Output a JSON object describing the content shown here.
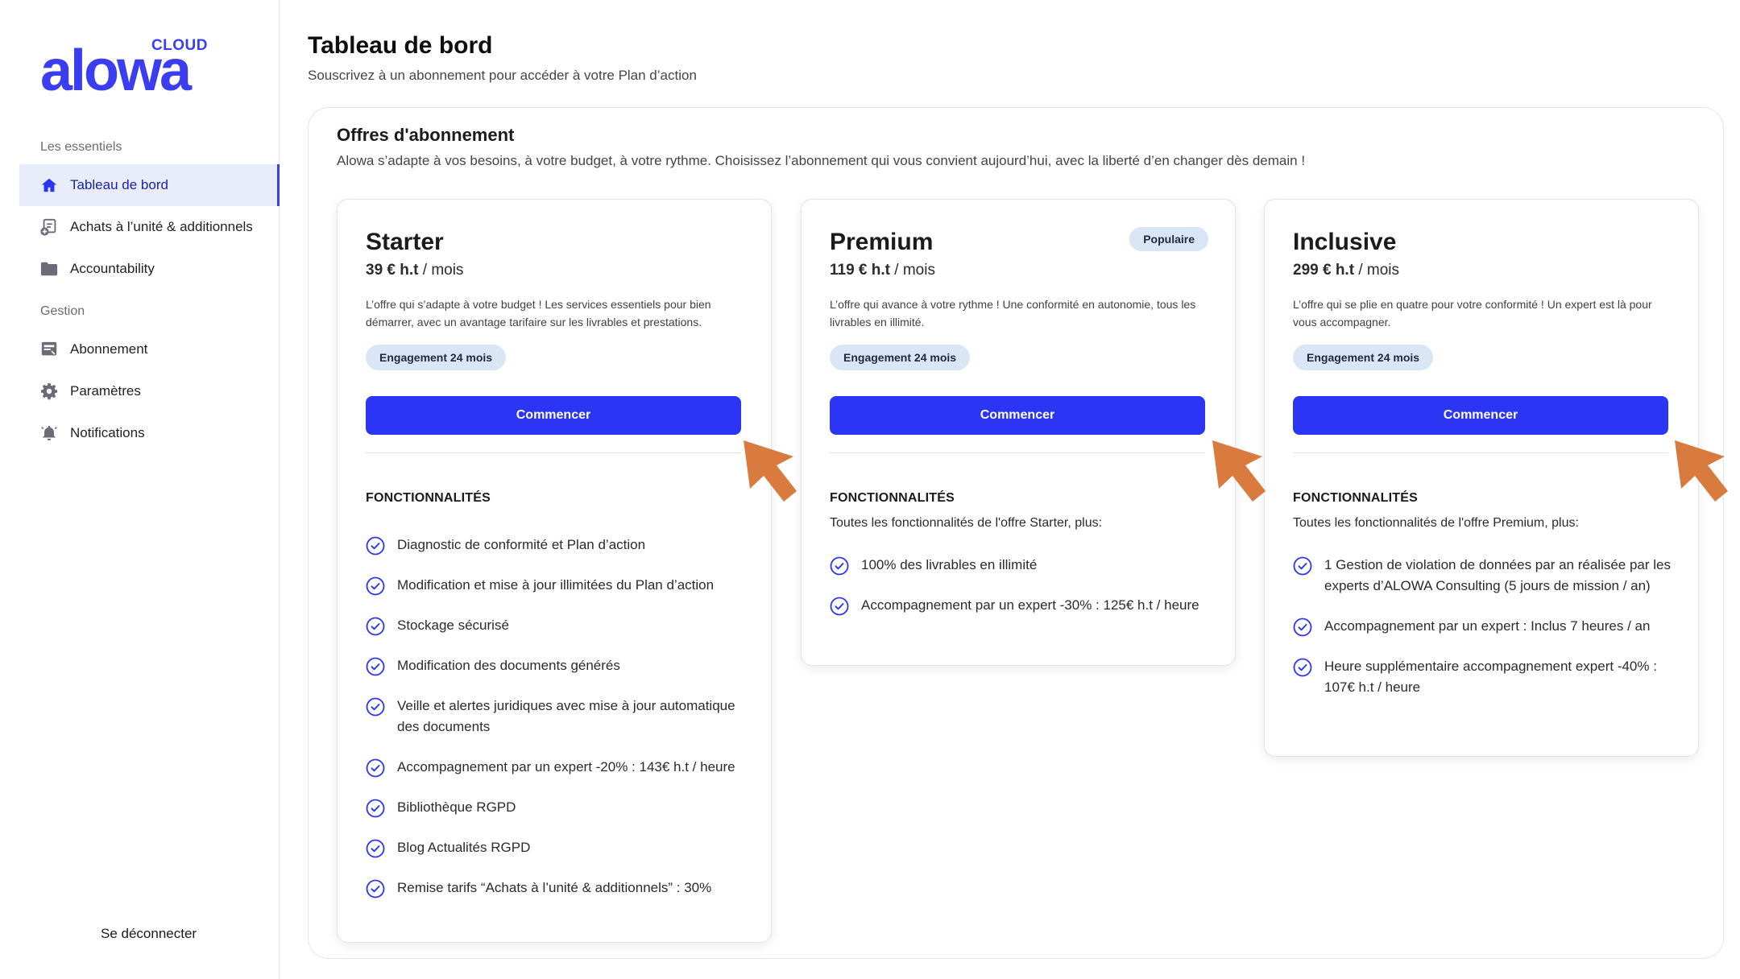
{
  "brand": {
    "wordmark": "alowa",
    "cloud": "CLOUD"
  },
  "sidebar": {
    "section1": "Les essentiels",
    "items1": [
      {
        "label": "Tableau de bord",
        "icon": "home-icon"
      },
      {
        "label": "Achats à l’unité & additionnels",
        "icon": "cart-add-icon"
      },
      {
        "label": "Accountability",
        "icon": "folder-icon"
      }
    ],
    "section2": "Gestion",
    "items2": [
      {
        "label": "Abonnement",
        "icon": "subscription-icon"
      },
      {
        "label": "Paramètres",
        "icon": "gear-icon"
      },
      {
        "label": "Notifications",
        "icon": "bell-icon"
      }
    ],
    "logout": "Se déconnecter"
  },
  "header": {
    "title": "Tableau de bord",
    "subtitle": "Souscrivez à un abonnement pour accéder à votre Plan d’action"
  },
  "offers": {
    "title": "Offres d'abonnement",
    "subtitle": "Alowa s’adapte à vos besoins, à votre budget, à votre rythme. Choisissez l’abonnement qui vous convient aujourd’hui, avec la liberté d’en changer dès demain !",
    "plans": [
      {
        "name": "Starter",
        "price": "39 € h.t",
        "period": " / mois",
        "description": "L’offre qui s’adapte à votre budget ! Les services essentiels pour bien démarrer, avec un avantage tarifaire sur les livrables et prestations.",
        "commitment": "Engagement 24 mois",
        "cta": "Commencer",
        "features_title": "FONCTIONNALITÉS",
        "features_intro": "",
        "features": [
          "Diagnostic de conformité et Plan d’action",
          "Modification et mise à jour illimitées du Plan d’action",
          "Stockage sécurisé",
          "Modification des documents générés",
          "Veille et alertes juridiques avec mise à jour automatique des documents",
          "Accompagnement par un expert -20% : 143€ h.t / heure",
          "Bibliothèque RGPD",
          "Blog Actualités RGPD",
          "Remise tarifs “Achats à l’unité & additionnels” : 30%"
        ]
      },
      {
        "name": "Premium",
        "badge": "Populaire",
        "price": "119 € h.t",
        "period": " / mois",
        "description": "L’offre qui avance à votre rythme ! Une conformité en autonomie, tous les livrables en illimité.",
        "commitment": "Engagement 24 mois",
        "cta": "Commencer",
        "features_title": "FONCTIONNALITÉS",
        "features_intro": "Toutes les fonctionnalités de l'offre Starter, plus:",
        "features": [
          "100% des livrables en illimité",
          "Accompagnement par un expert -30% : 125€ h.t / heure"
        ]
      },
      {
        "name": "Inclusive",
        "price": "299 € h.t",
        "period": " / mois",
        "description": "L’offre qui se plie en quatre pour votre conformité ! Un expert est là pour vous accompagner.",
        "commitment": "Engagement 24 mois",
        "cta": "Commencer",
        "features_title": "FONCTIONNALITÉS",
        "features_intro": "Toutes les fonctionnalités de l'offre Premium, plus:",
        "features": [
          "1 Gestion de violation de données par an réalisée par les experts d’ALOWA Consulting (5 jours de mission / an)",
          "Accompagnement par un expert : Inclus 7 heures / an",
          "Heure supplémentaire accompagnement expert -40% : 107€ h.t / heure"
        ]
      }
    ]
  },
  "colors": {
    "accent": "#2b35f3",
    "badge_bg": "#d9e6f6",
    "arrow": "#d97a3f"
  }
}
